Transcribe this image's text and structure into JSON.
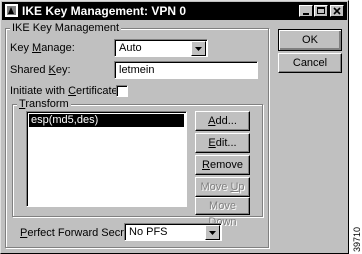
{
  "window": {
    "title": "IKE Key Management: VPN 0"
  },
  "group_main": {
    "label": "IKE Key Management"
  },
  "key_manage": {
    "label": "Key Manage:",
    "value": "Auto"
  },
  "shared_key": {
    "label": "Shared Key:",
    "value": "letmein"
  },
  "certificates": {
    "label": "Initiate with Certificates:",
    "checked": false
  },
  "transform": {
    "label": "Transform",
    "items": [
      "esp(md5,des)"
    ]
  },
  "buttons": {
    "ok": "OK",
    "cancel": "Cancel",
    "add": "Add...",
    "edit": "Edit...",
    "remove": "Remove",
    "move_up": "Move Up",
    "move_down": "Move Down"
  },
  "pfs": {
    "label": "Perfect Forward Secrecy:",
    "value": "No PFS"
  },
  "figure_code": "39710"
}
